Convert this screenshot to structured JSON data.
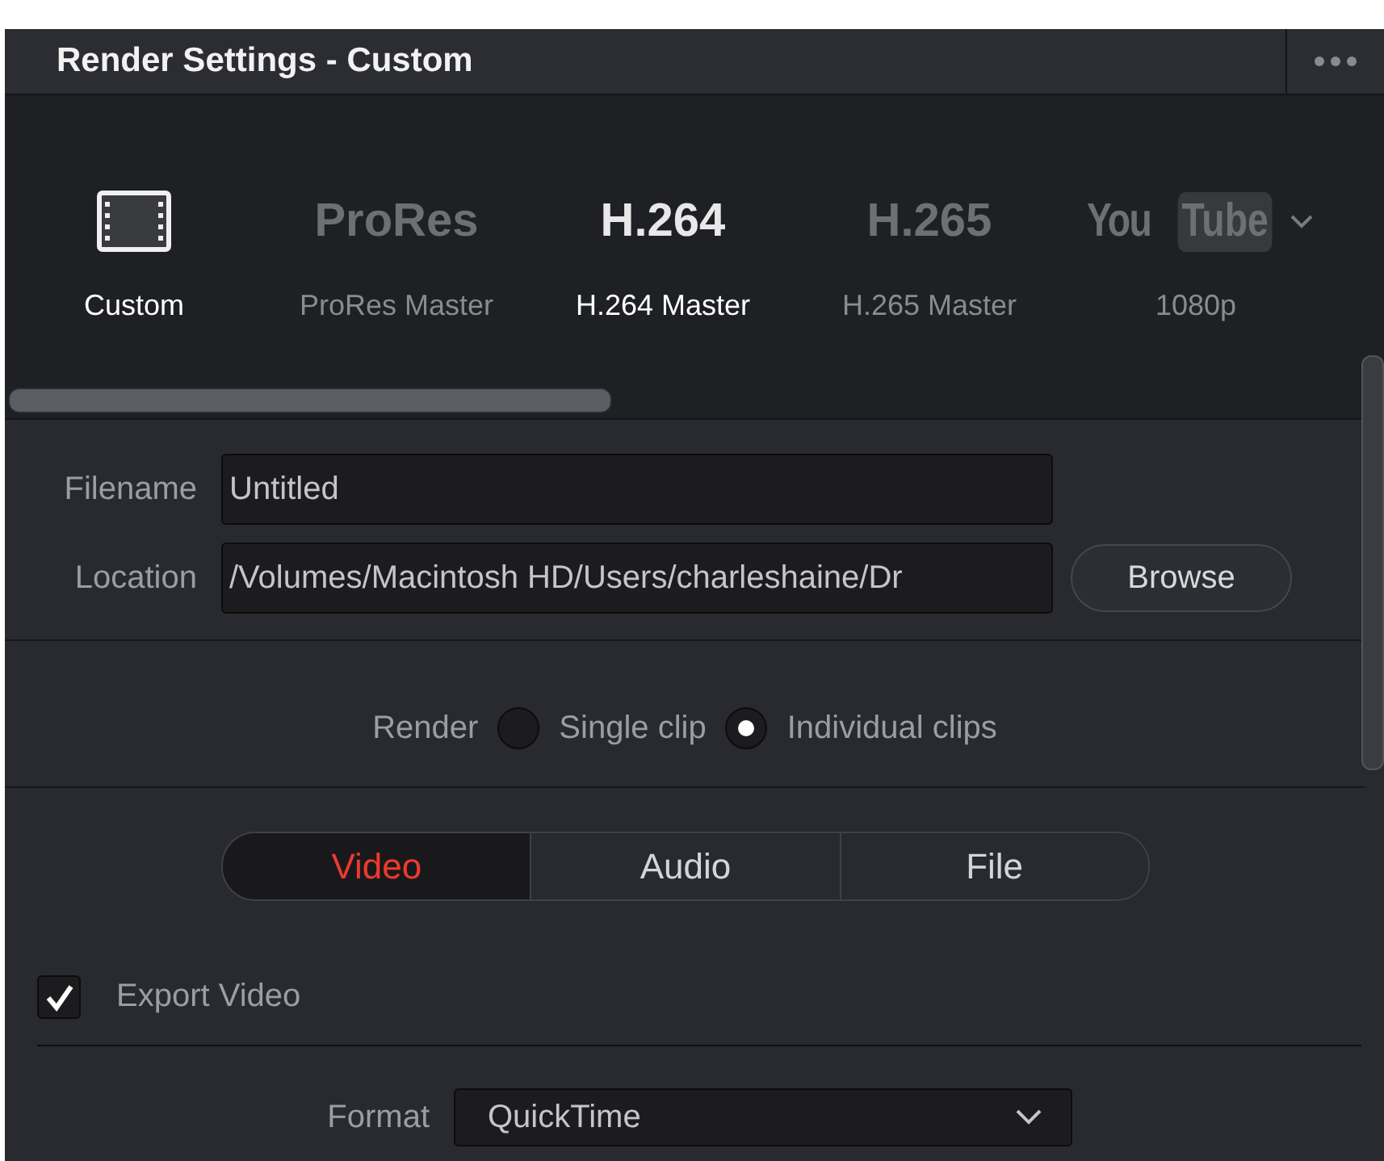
{
  "window": {
    "title": "Render Settings - Custom"
  },
  "presets": [
    {
      "kind": "icon",
      "label": "Custom",
      "highlighted": true
    },
    {
      "kind": "text",
      "logo": "ProRes",
      "label": "ProRes Master",
      "highlighted": false
    },
    {
      "kind": "text",
      "logo": "H.264",
      "label": "H.264 Master",
      "highlighted": true
    },
    {
      "kind": "text",
      "logo": "H.265",
      "label": "H.265 Master",
      "highlighted": false
    },
    {
      "kind": "youtube",
      "logo": "You",
      "logo_box": "Tube",
      "label": "1080p",
      "highlighted": false
    }
  ],
  "file": {
    "fields": [
      {
        "label": "Filename",
        "value": "Untitled"
      },
      {
        "label": "Location",
        "value": "/Volumes/Macintosh HD/Users/charleshaine/Dr"
      }
    ],
    "browse_button": "Browse"
  },
  "render": {
    "label": "Render",
    "options": [
      {
        "label": "Single clip",
        "selected": false
      },
      {
        "label": "Individual clips",
        "selected": true
      }
    ]
  },
  "tabs": [
    {
      "label": "Video",
      "selected": true
    },
    {
      "label": "Audio",
      "selected": false
    },
    {
      "label": "File",
      "selected": false
    }
  ],
  "export_video": {
    "label": "Export Video",
    "checked": true
  },
  "format": {
    "label": "Format",
    "value": "QuickTime"
  }
}
